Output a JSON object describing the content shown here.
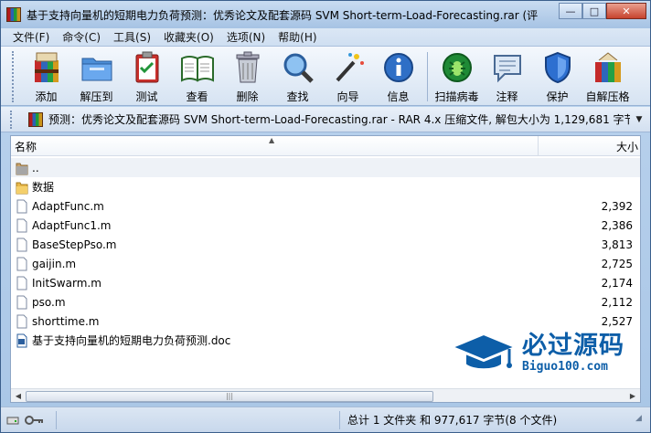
{
  "window": {
    "title": "基于支持向量机的短期电力负荷预测：优秀论文及配套源码 SVM Short-term-Load-Forecasting.rar (评",
    "min": "—",
    "max": "□",
    "close": "✕"
  },
  "menu": [
    "文件(F)",
    "命令(C)",
    "工具(S)",
    "收藏夹(O)",
    "选项(N)",
    "帮助(H)"
  ],
  "toolbar": {
    "tools": [
      {
        "label": "添加",
        "icon": "add-archive-icon"
      },
      {
        "label": "解压到",
        "icon": "extract-folder-icon"
      },
      {
        "label": "测试",
        "icon": "test-clipboard-icon"
      },
      {
        "label": "查看",
        "icon": "view-book-icon"
      },
      {
        "label": "删除",
        "icon": "trash-can-icon"
      },
      {
        "label": "查找",
        "icon": "magnifier-icon"
      },
      {
        "label": "向导",
        "icon": "wizard-wand-icon"
      },
      {
        "label": "信息",
        "icon": "info-icon"
      },
      {
        "label": "扫描病毒",
        "icon": "virus-scan-icon"
      },
      {
        "label": "注释",
        "icon": "comment-icon"
      },
      {
        "label": "保护",
        "icon": "shield-icon"
      },
      {
        "label": "自解压格",
        "icon": "sfx-archive-icon"
      }
    ]
  },
  "address": {
    "text": "预测：优秀论文及配套源码 SVM Short-term-Load-Forecasting.rar - RAR 4.x 压缩文件, 解包大小为 1,129,681 字节"
  },
  "list": {
    "headers": {
      "name": "名称",
      "size": "大小"
    },
    "rows": [
      {
        "name": "..",
        "size": "",
        "type": "parent"
      },
      {
        "name": "数据",
        "size": "",
        "type": "folder"
      },
      {
        "name": "AdaptFunc.m",
        "size": "2,392",
        "type": "file"
      },
      {
        "name": "AdaptFunc1.m",
        "size": "2,386",
        "type": "file"
      },
      {
        "name": "BaseStepPso.m",
        "size": "3,813",
        "type": "file"
      },
      {
        "name": "gaijin.m",
        "size": "2,725",
        "type": "file"
      },
      {
        "name": "InitSwarm.m",
        "size": "2,174",
        "type": "file"
      },
      {
        "name": "pso.m",
        "size": "2,112",
        "type": "file"
      },
      {
        "name": "shorttime.m",
        "size": "2,527",
        "type": "file"
      },
      {
        "name": "基于支持向量机的短期电力负荷预测.doc",
        "size": "",
        "type": "doc"
      }
    ]
  },
  "watermark": {
    "main": "必过源码",
    "sub": "Biguo100.com"
  },
  "status": {
    "right": "总计 1 文件夹 和 977,617 字节(8 个文件)"
  },
  "colors": {
    "accent": "#0d5ea8",
    "titlebar": "#a6c3e4",
    "close": "#c7432e"
  }
}
